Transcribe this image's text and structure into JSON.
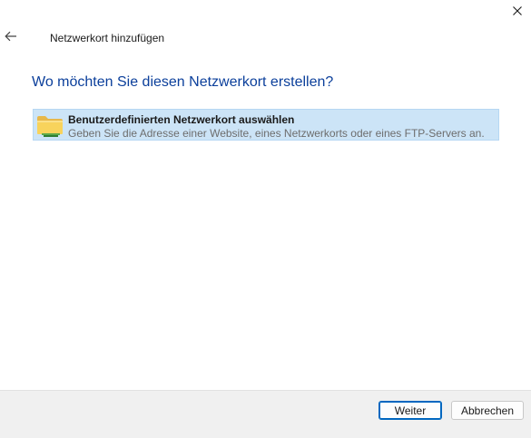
{
  "window": {
    "title": "Netzwerkort hinzufügen",
    "close_icon": "close-icon",
    "back_icon": "arrow-left-icon"
  },
  "main": {
    "heading": "Wo möchten Sie diesen Netzwerkort erstellen?",
    "option": {
      "icon": "folder-icon",
      "title": "Benutzerdefinierten Netzwerkort auswählen",
      "description": "Geben Sie die Adresse einer Website, eines Netzwerkorts oder eines FTP-Servers an."
    }
  },
  "footer": {
    "next_label": "Weiter",
    "cancel_label": "Abbrechen"
  },
  "colors": {
    "heading": "#0b3f9b",
    "selection_bg": "#cce4f7",
    "primary_border": "#0067c0",
    "footer_bg": "#f0f0f0"
  }
}
